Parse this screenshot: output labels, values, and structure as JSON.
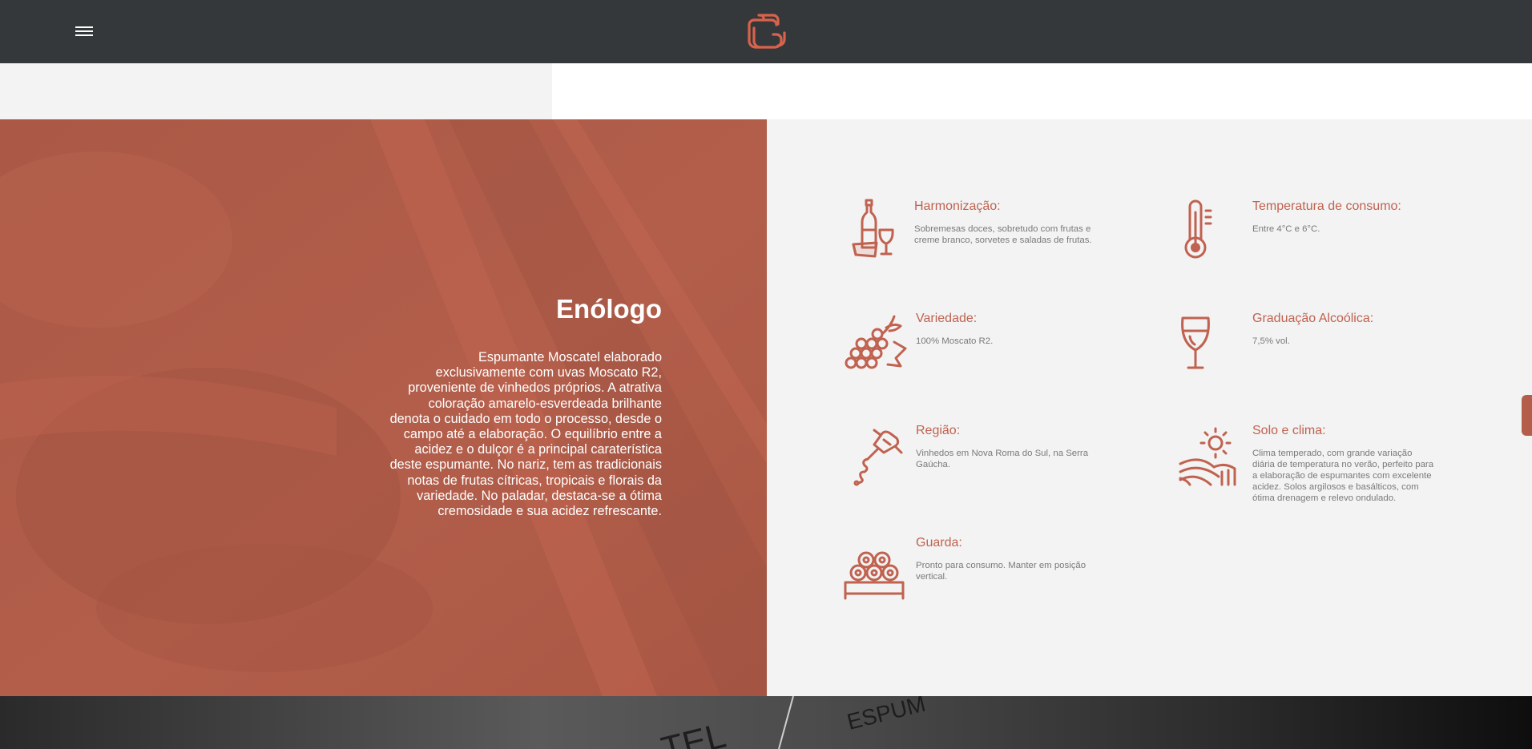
{
  "header": {
    "menu_icon": "hamburger-menu-icon",
    "logo_icon": "brand-logo-icon",
    "background": "#35383a",
    "accent": "#d8634c"
  },
  "hero": {
    "title": "Enólogo",
    "lines": [
      "Espumante Moscatel elaborado",
      "exclusivamente com uvas Moscato R2,",
      "proveniente de vinhedos próprios. A atrativa",
      "coloração  amarelo-esverdeada brilhante",
      "denota o cuidado em todo o processo, desde o",
      "campo até a elaboração.  O equilíbrio entre a",
      "acidez e o dulçor é a principal caraterística",
      "deste espumante. No nariz, tem as tradicionais",
      "notas de frutas cítricas, tropicais e florais da",
      "variedade. No paladar, destaca-se a ótima",
      "cremosidade e sua acidez refrescante."
    ],
    "background": "#b25e4b"
  },
  "specs": {
    "accent": "#c0624f",
    "items": [
      {
        "icon": "wine-bottle-glass-icon",
        "title": "Harmonização:",
        "lines": [
          "Sobremesas doces, sobretudo com frutas e",
          "creme branco, sorvetes e saladas de frutas."
        ]
      },
      {
        "icon": "thermometer-icon",
        "title": "Temperatura de consumo:",
        "lines": [
          "Entre 4°C e 6°C."
        ]
      },
      {
        "icon": "grapes-icon",
        "title": "Variedade:",
        "lines": [
          "100% Moscato R2."
        ]
      },
      {
        "icon": "wine-glass-icon",
        "title": "Graduação Alcoólica:",
        "lines": [
          "7,5% vol."
        ]
      },
      {
        "icon": "corkscrew-icon",
        "title": "Região:",
        "lines": [
          "Vinhedos em Nova Roma do Sul, na Serra",
          "Gaúcha."
        ]
      },
      {
        "icon": "sun-vineyard-icon",
        "title": "Solo e clima:",
        "lines": [
          "Clima temperado, com grande variação",
          "diária de temperatura no verão, perfeito para",
          "a elaboração de espumantes com excelente",
          "acidez. Solos argilosos e basálticos, com",
          "ótima drenagem e relevo ondulado."
        ]
      },
      {
        "icon": "wine-rack-icon",
        "title": "Guarda:",
        "lines": [
          "Pronto para consumo. Manter em posição",
          "vertical."
        ]
      }
    ]
  },
  "footer": {
    "photo_text": [
      "ESPUM",
      "TEL"
    ]
  }
}
